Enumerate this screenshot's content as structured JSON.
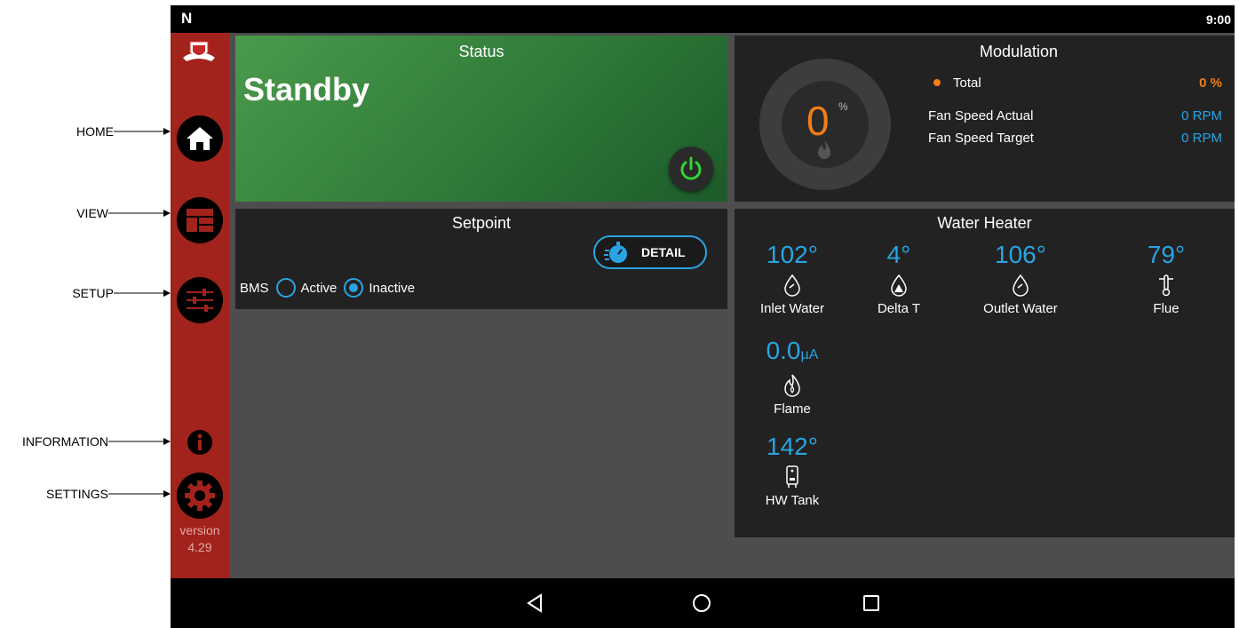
{
  "callouts": {
    "home": "HOME",
    "view": "VIEW",
    "setup": "SETUP",
    "information": "INFORMATION",
    "settings": "SETTINGS"
  },
  "statusbar": {
    "logo": "N",
    "time": "9:00"
  },
  "sidebar": {
    "items": [
      {
        "name": "home",
        "icon": "home-icon"
      },
      {
        "name": "view",
        "icon": "dashboard-icon"
      },
      {
        "name": "setup",
        "icon": "sliders-icon"
      },
      {
        "name": "information",
        "icon": "info-icon"
      },
      {
        "name": "settings",
        "icon": "gear-icon"
      }
    ],
    "version_label": "version",
    "version_number": "4.29"
  },
  "status": {
    "title": "Status",
    "value": "Standby"
  },
  "setpoint": {
    "title": "Setpoint",
    "detail_label": "DETAIL",
    "bms_label": "BMS",
    "options": [
      "Active",
      "Inactive"
    ],
    "selected": "Inactive"
  },
  "modulation": {
    "title": "Modulation",
    "gauge_value": "0",
    "gauge_unit": "%",
    "total_label": "Total",
    "total_value": "0 %",
    "fan_actual_label": "Fan Speed Actual",
    "fan_actual_value": "0 RPM",
    "fan_target_label": "Fan Speed Target",
    "fan_target_value": "0 RPM"
  },
  "water_heater": {
    "title": "Water Heater",
    "inlet": {
      "value": "102°",
      "label": "Inlet Water"
    },
    "delta": {
      "value": "4°",
      "label": "Delta T"
    },
    "outlet": {
      "value": "106°",
      "label": "Outlet Water"
    },
    "flue": {
      "value": "79°",
      "label": "Flue"
    },
    "flame": {
      "value": "0.0",
      "unit": "µA",
      "label": "Flame"
    },
    "tank": {
      "value": "142°",
      "label": "HW Tank"
    }
  },
  "colors": {
    "accent_blue": "#2aa3e2",
    "accent_orange": "#f07d17",
    "sidebar_red": "#a1231c",
    "power_green": "#33d433"
  }
}
